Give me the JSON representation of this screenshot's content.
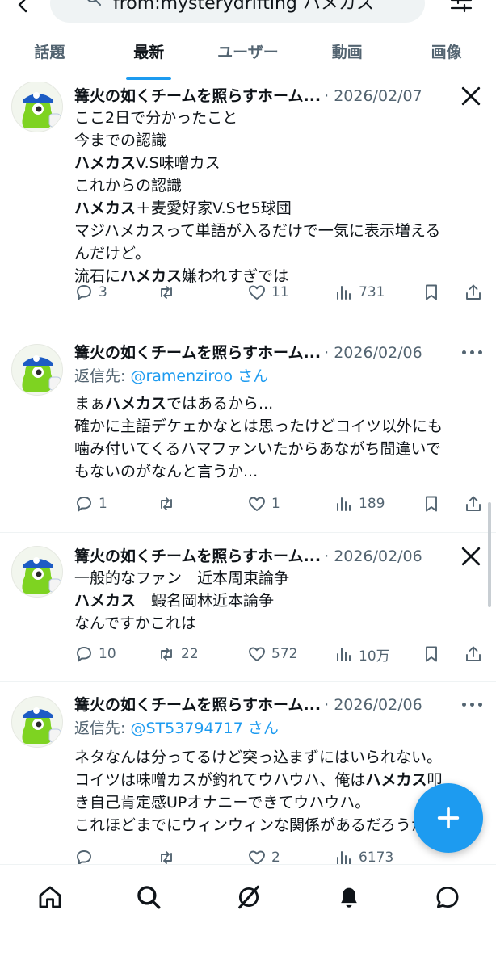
{
  "search": {
    "query": "from:mysterydrifting ハメカス"
  },
  "tabs": [
    {
      "label": "話題"
    },
    {
      "label": "最新"
    },
    {
      "label": "ユーザー"
    },
    {
      "label": "動画"
    },
    {
      "label": "画像"
    }
  ],
  "active_tab": "最新",
  "tweets": [
    {
      "name": "篝火の如くチームを照らすホーム...",
      "date": "· 2026/02/07",
      "corner": "x-logo-icon",
      "lines": [
        {
          "pre": "ここ2日で分かったこと"
        },
        {
          "pre": "今までの認識"
        },
        {
          "bold": "ハメカス",
          "post": "V.S味噌カス"
        },
        {
          "pre": "これからの認識"
        },
        {
          "bold": "ハメカス",
          "post": "＋麦愛好家V.Sセ5球団"
        },
        {
          "pre": "マジハメカスって単語が入るだけで一気に表示増える"
        },
        {
          "pre": "んだけど。"
        },
        {
          "pre": "流石に",
          "bold": "ハメカス",
          "post": "嫌われすぎでは"
        }
      ],
      "replies": "3",
      "retweets": "",
      "likes": "11",
      "views": "731"
    },
    {
      "name": "篝火の如くチームを照らすホーム...",
      "date": "· 2026/02/06",
      "corner": "more-icon",
      "reply_prefix": "返信先: ",
      "reply_handle": "@ramenziroo さん",
      "lines": [
        {
          "pre": "まぁ",
          "bold": "ハメカス",
          "post": "ではあるから..."
        },
        {
          "pre": "確かに主語デケェかなとは思ったけどコイツ以外にも"
        },
        {
          "pre": "噛み付いてくるハマファンいたからあながち間違いで"
        },
        {
          "pre": "もないのがなんと言うか..."
        }
      ],
      "replies": "1",
      "retweets": "",
      "likes": "1",
      "views": "189"
    },
    {
      "name": "篝火の如くチームを照らすホーム...",
      "date": "· 2026/02/06",
      "corner": "x-logo-icon",
      "lines": [
        {
          "pre": "一般的なファン　近本周東論争"
        },
        {
          "bold": "ハメカス",
          "post": "　蝦名岡林近本論争"
        },
        {
          "pre": "なんですかこれは"
        }
      ],
      "replies": "10",
      "retweets": "22",
      "likes": "572",
      "views": "10万"
    },
    {
      "name": "篝火の如くチームを照らすホーム...",
      "date": "· 2026/02/06",
      "corner": "more-icon",
      "reply_prefix": "返信先: ",
      "reply_handle": "@ST53794717 さん",
      "lines": [
        {
          "pre": "ネタなんは分ってるけど突っ込まずにはいられない。"
        },
        {
          "pre": "コイツは味噌カスが釣れてウハウハ、俺は",
          "bold": "ハメカス",
          "post": "叩"
        },
        {
          "pre": "き自己肯定感UPオナニーできてウハウハ。"
        },
        {
          "pre": "これほどまでにウィンウィンな関係があるだろうか"
        }
      ],
      "replies": "",
      "retweets": "",
      "likes": "2",
      "views": "6173"
    }
  ],
  "icons": {
    "back": "back-arrow-icon",
    "search": "search-icon",
    "filter": "filter-icon",
    "fab": "plus-icon",
    "nav": [
      "home-icon",
      "search-icon",
      "grok-icon",
      "notifications-icon",
      "messages-icon"
    ]
  },
  "colors": {
    "accent": "#1d9bf0",
    "text": "#0f1419",
    "muted": "#536471"
  }
}
